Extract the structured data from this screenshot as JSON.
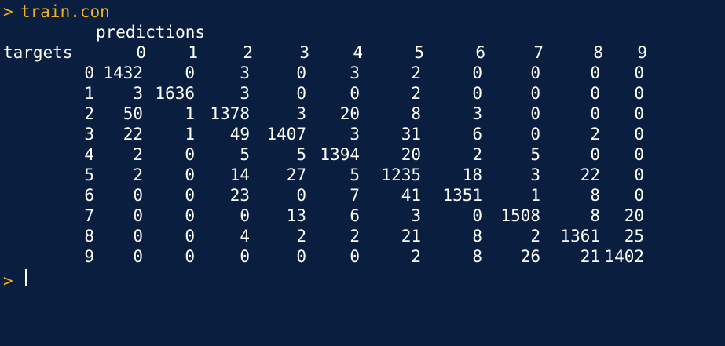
{
  "prompt": ">",
  "command": "train.con",
  "header": {
    "predictions_label": "predictions",
    "targets_label": "targets"
  },
  "columns": [
    "0",
    "1",
    "2",
    "3",
    "4",
    "5",
    "6",
    "7",
    "8",
    "9"
  ],
  "rows": [
    {
      "label": "0",
      "values": [
        "1432",
        "0",
        "3",
        "0",
        "3",
        "2",
        "0",
        "0",
        "0",
        "0"
      ]
    },
    {
      "label": "1",
      "values": [
        "3",
        "1636",
        "3",
        "0",
        "0",
        "2",
        "0",
        "0",
        "0",
        "0"
      ]
    },
    {
      "label": "2",
      "values": [
        "50",
        "1",
        "1378",
        "3",
        "20",
        "8",
        "3",
        "0",
        "0",
        "0"
      ]
    },
    {
      "label": "3",
      "values": [
        "22",
        "1",
        "49",
        "1407",
        "3",
        "31",
        "6",
        "0",
        "2",
        "0"
      ]
    },
    {
      "label": "4",
      "values": [
        "2",
        "0",
        "5",
        "5",
        "1394",
        "20",
        "2",
        "5",
        "0",
        "0"
      ]
    },
    {
      "label": "5",
      "values": [
        "2",
        "0",
        "14",
        "27",
        "5",
        "1235",
        "18",
        "3",
        "22",
        "0"
      ]
    },
    {
      "label": "6",
      "values": [
        "0",
        "0",
        "23",
        "0",
        "7",
        "41",
        "1351",
        "1",
        "8",
        "0"
      ]
    },
    {
      "label": "7",
      "values": [
        "0",
        "0",
        "0",
        "13",
        "6",
        "3",
        "0",
        "1508",
        "8",
        "20"
      ]
    },
    {
      "label": "8",
      "values": [
        "0",
        "0",
        "4",
        "2",
        "2",
        "21",
        "8",
        "2",
        "1361",
        "25"
      ]
    },
    {
      "label": "9",
      "values": [
        "0",
        "0",
        "0",
        "0",
        "0",
        "2",
        "8",
        "26",
        "21",
        "1402"
      ]
    }
  ],
  "colors": {
    "background": "#0a1e3f",
    "prompt": "#f0b020",
    "text": "#ffffff"
  }
}
